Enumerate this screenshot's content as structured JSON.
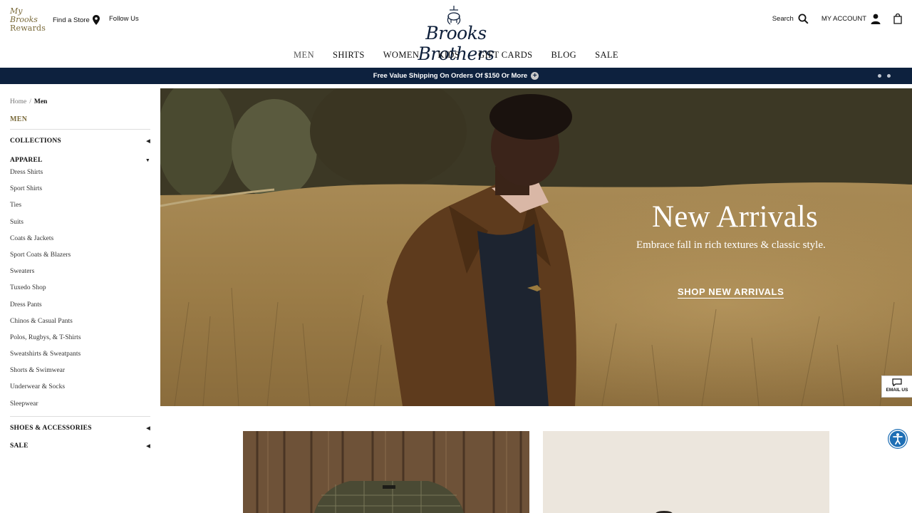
{
  "header": {
    "rewards_logo_line1": "My Brooks",
    "rewards_logo_line2": "Rewards",
    "find_store": "Find a Store",
    "follow_us": "Follow Us",
    "brand": "Brooks Brothers",
    "search": "Search",
    "account": "MY ACCOUNT"
  },
  "nav": [
    "MEN",
    "SHIRTS",
    "WOMEN",
    "KIDS",
    "GIFT CARDS",
    "BLOG",
    "SALE"
  ],
  "promo": {
    "text": "Free Value Shipping On Orders Of $150 Or More",
    "plus": "+",
    "background": "#0d213e"
  },
  "breadcrumb": {
    "home": "Home",
    "separator": "/",
    "current": "Men"
  },
  "sidebar": {
    "title": "MEN",
    "collections": "COLLECTIONS",
    "apparel": "APPAREL",
    "apparel_items": [
      "Dress Shirts",
      "Sport Shirts",
      "Ties",
      "Suits",
      "Coats & Jackets",
      "Sport Coats & Blazers",
      "Sweaters",
      "Tuxedo Shop",
      "Dress Pants",
      "Chinos & Casual Pants",
      "Polos, Rugbys, & T-Shirts",
      "Sweatshirts & Sweatpants",
      "Shorts & Swimwear",
      "Underwear & Socks",
      "Sleepwear"
    ],
    "shoes": "SHOES & ACCESSORIES",
    "sale": "SALE"
  },
  "hero": {
    "title": "New Arrivals",
    "subtitle": "Embrace fall in rich textures & classic style.",
    "cta": "SHOP NEW ARRIVALS"
  },
  "widgets": {
    "email_us": "EMAIL US"
  },
  "icons": {
    "find_store": "map-pin-icon",
    "search": "search-icon",
    "account": "user-icon",
    "bag": "shopping-bag-icon",
    "chat": "chat-bubble-icon",
    "accessibility": "accessibility-icon"
  }
}
